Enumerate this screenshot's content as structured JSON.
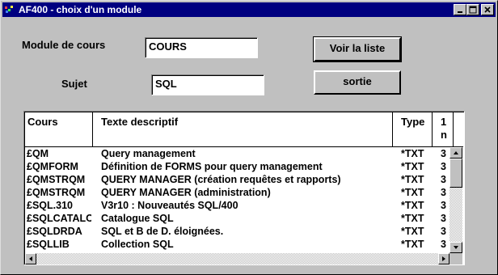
{
  "window": {
    "title": "AF400 - choix d'un module"
  },
  "form": {
    "module_label": "Module de cours",
    "module_value": "COURS",
    "sujet_label": "Sujet",
    "sujet_value": "SQL",
    "voir_button": "Voir la liste",
    "sortie_button": "sortie"
  },
  "table": {
    "headers": [
      "Cours",
      "Texte descriptif",
      "Type",
      "1\nn"
    ],
    "rows": [
      [
        "£QM",
        "Query management",
        "*TXT",
        "3"
      ],
      [
        "£QMFORM",
        "Définition de FORMS pour query management",
        "*TXT",
        "3"
      ],
      [
        "£QMSTRQM",
        "QUERY MANAGER (création requêtes et rapports)",
        "*TXT",
        "3"
      ],
      [
        "£QMSTRQM",
        "QUERY MANAGER (administration)",
        "*TXT",
        "3"
      ],
      [
        "£SQL.310",
        "V3r10 : Nouveautés SQL/400",
        "*TXT",
        "3"
      ],
      [
        "£SQLCATALOG",
        "Catalogue SQL",
        "*TXT",
        "3"
      ],
      [
        "£SQLDRDA",
        "SQL et B de D. éloignées.",
        "*TXT",
        "3"
      ],
      [
        "£SQLLIB",
        "Collection SQL",
        "*TXT",
        "3"
      ]
    ]
  },
  "icons": {
    "app": "app-icon",
    "minimize": "minimize-icon",
    "maximize": "maximize-icon",
    "close": "close-icon"
  }
}
